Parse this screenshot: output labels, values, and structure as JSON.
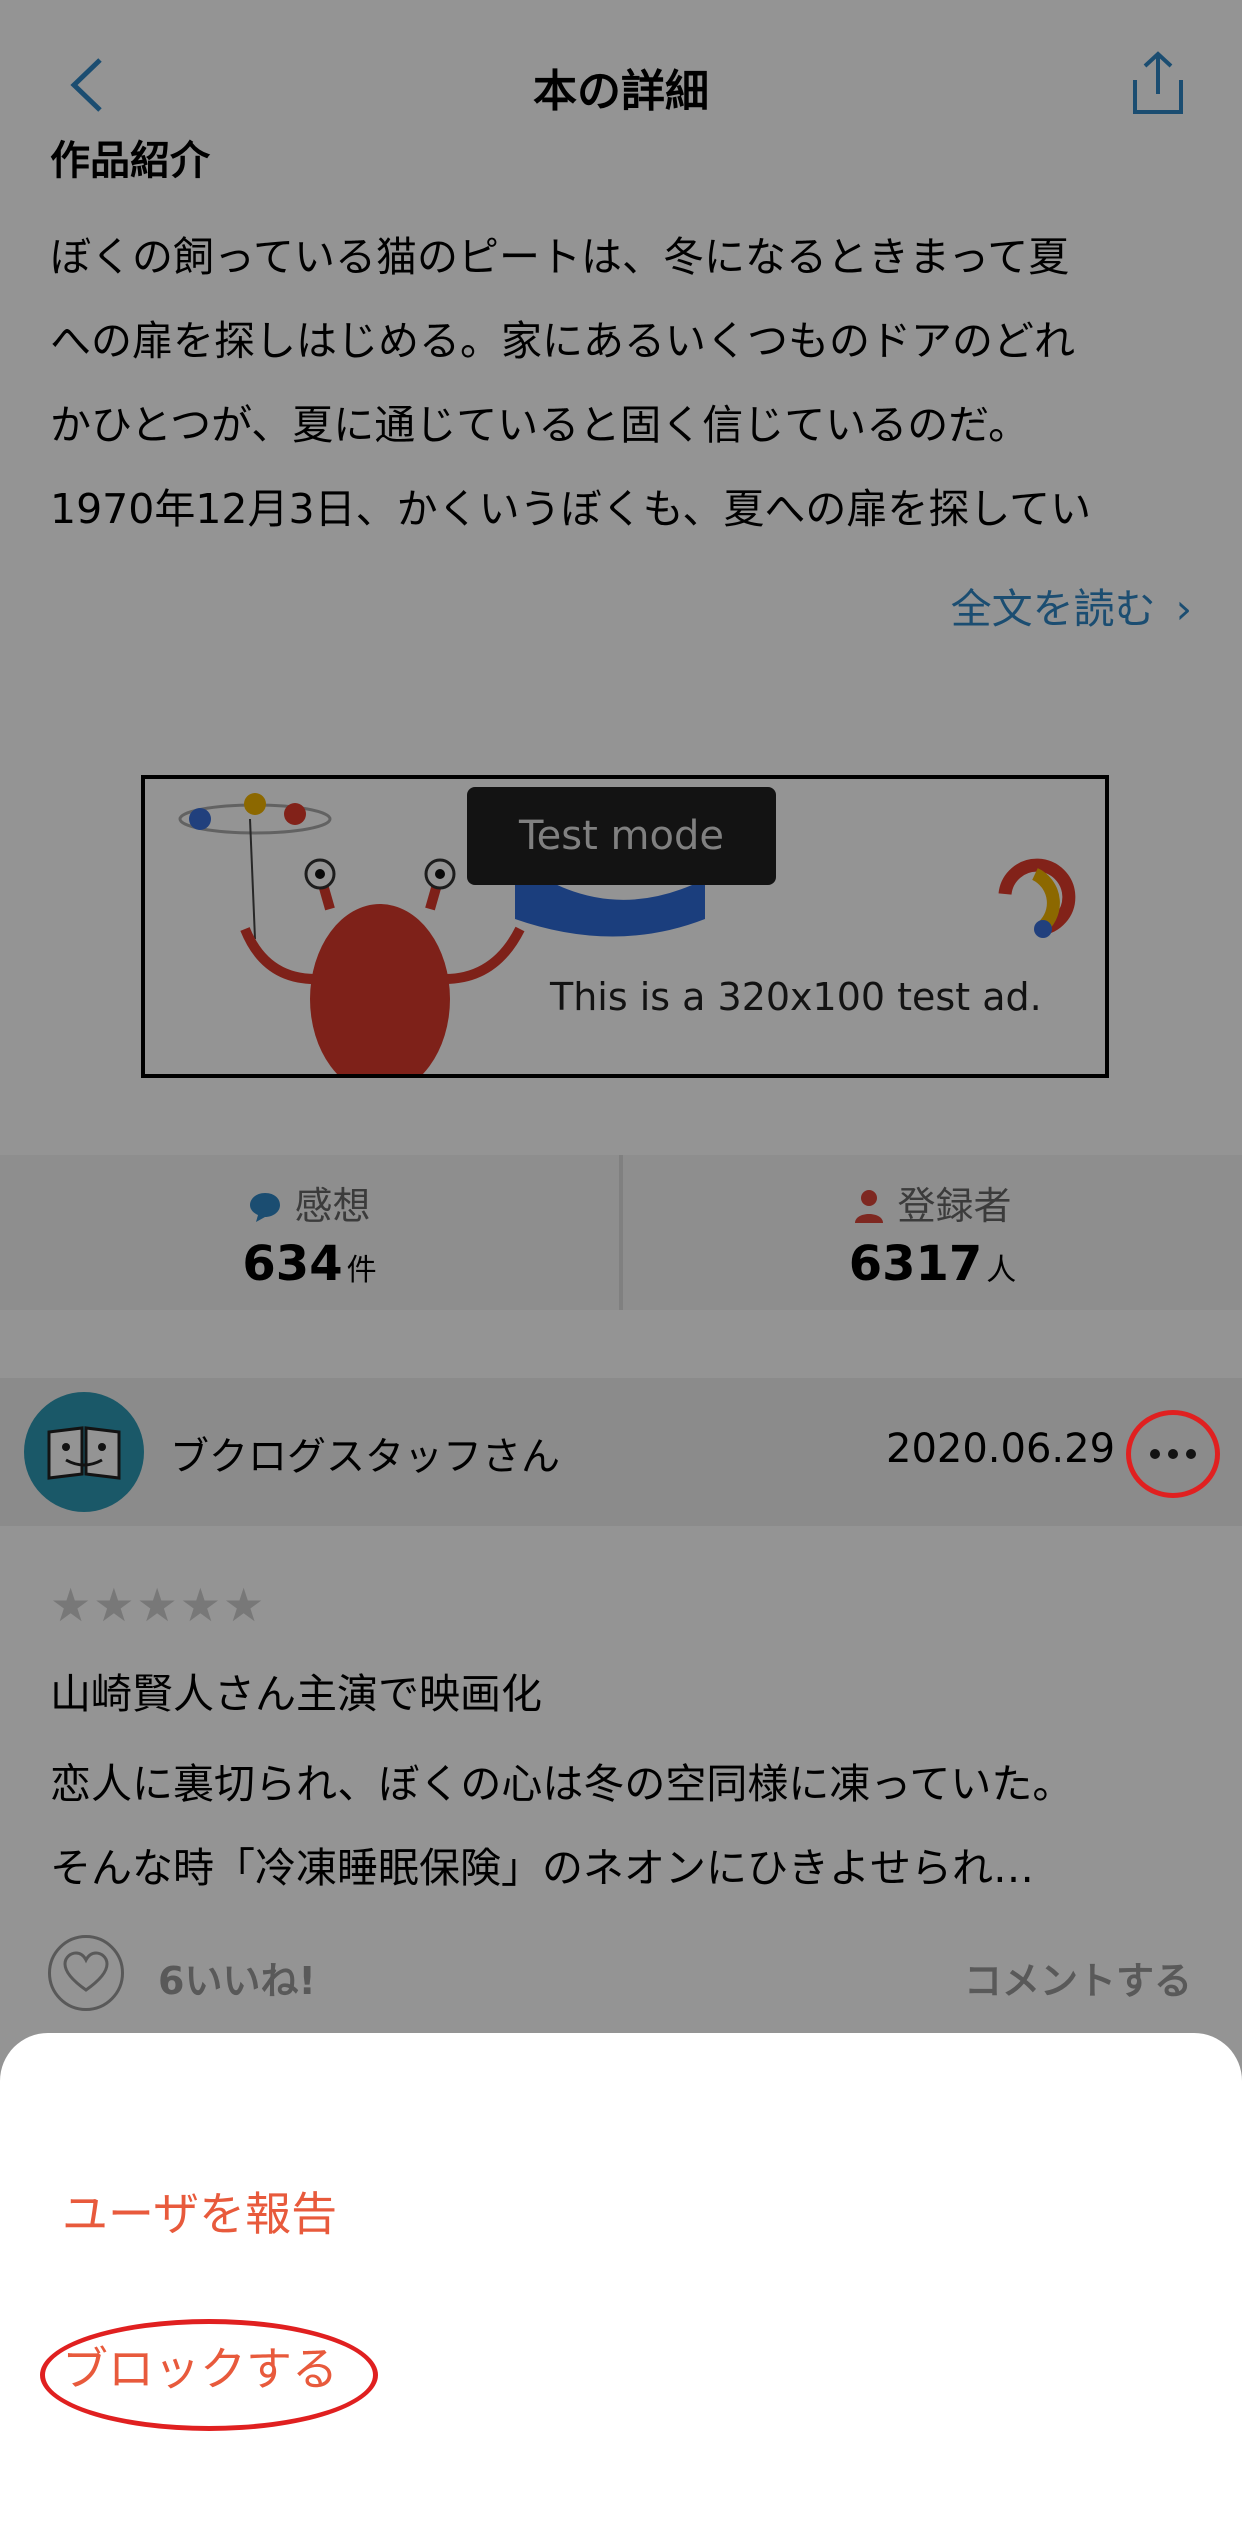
{
  "header": {
    "title": "本の詳細",
    "back_icon": "chevron-left-icon",
    "share_icon": "share-icon"
  },
  "summary": {
    "heading": "作品紹介",
    "text": "ぼくの飼っている猫のピートは、冬になるときまって夏\nへの扉を探しはじめる。家にあるいくつものドアのどれ\nかひとつが、夏に通じていると固く信じているのだ。\n1970年12月3日、かくいうぼくも、夏への扉を探してい",
    "read_more": "全文を読む",
    "read_more_chevron": "›"
  },
  "ad": {
    "badge": "Test mode",
    "text": "This is a 320x100 test ad."
  },
  "stats": {
    "impressions_label": "感想",
    "impressions_value": "634",
    "impressions_unit": "件",
    "registered_label": "登録者",
    "registered_value": "6317",
    "registered_unit": "人"
  },
  "review": {
    "user": "ブクログスタッフさん",
    "date": "2020.06.29",
    "stars": "★★★★★",
    "title": "山崎賢人さん主演で映画化",
    "body": "恋人に裏切られ、ぼくの心は冬の空同様に凍っていた。\nそんな時「冷凍睡眠保険」のネオンにひきよせられ…",
    "likes": "6いいね!",
    "comment": "コメントする"
  },
  "action_sheet": {
    "report": "ユーザを報告",
    "block": "ブロックする"
  },
  "colors": {
    "accent_blue": "#2f86c3",
    "danger": "#e85a3c",
    "highlight": "#e02020"
  }
}
